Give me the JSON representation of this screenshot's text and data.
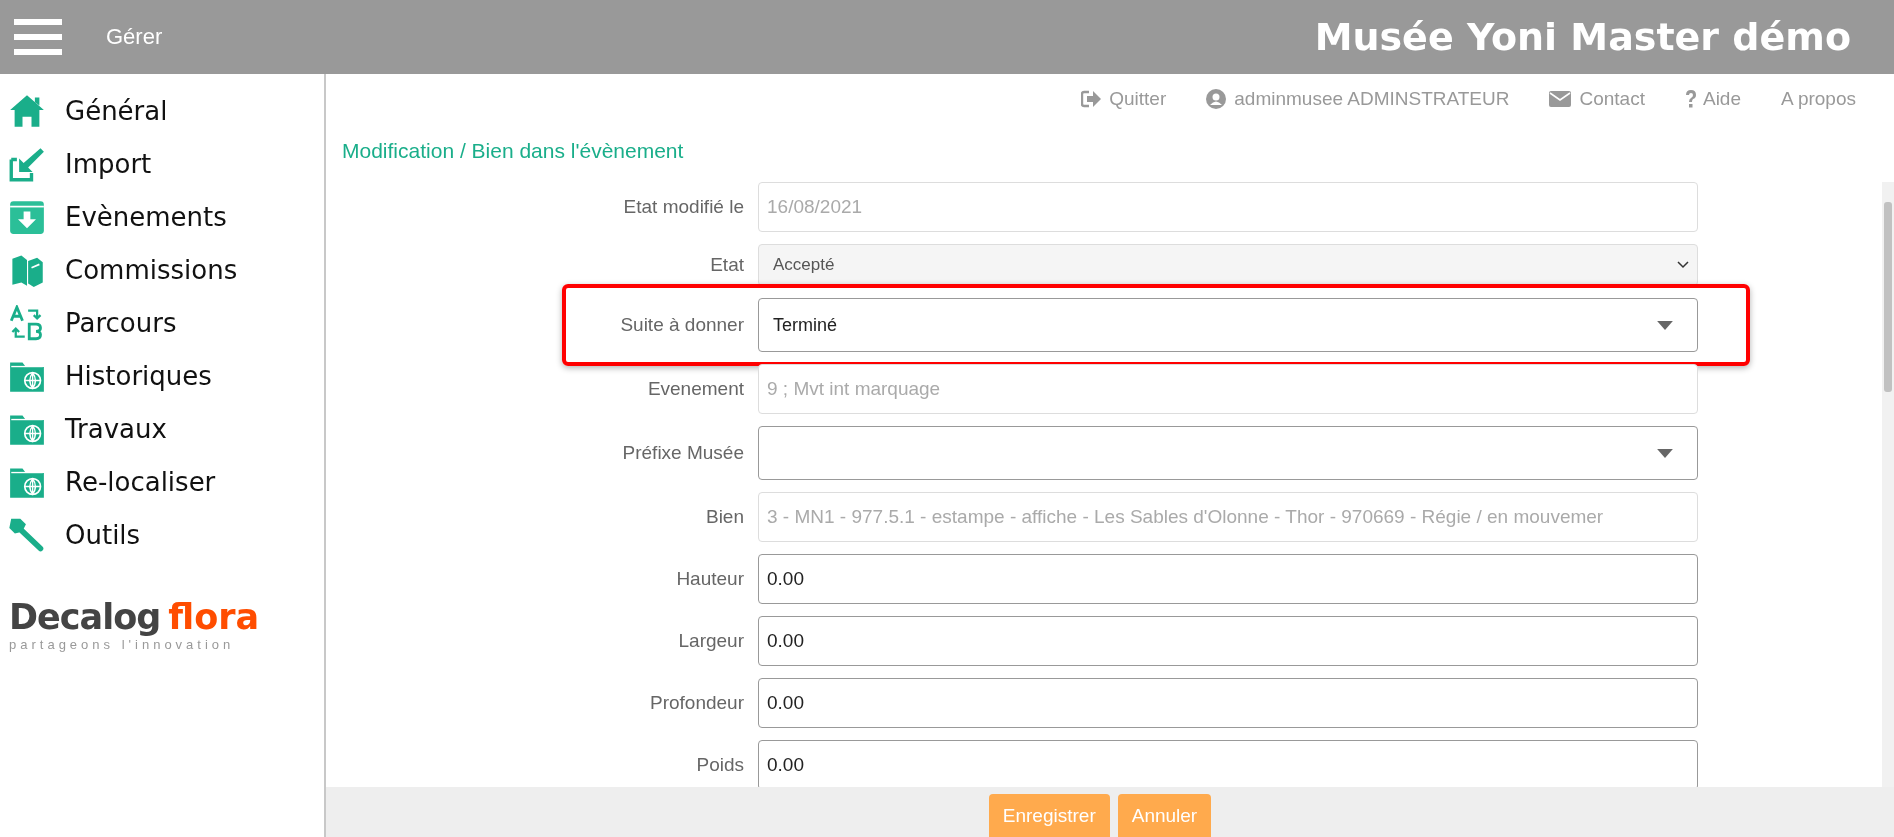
{
  "header": {
    "menu_label": "Gérer",
    "title": "Musée Yoni Master démo"
  },
  "sidebar": {
    "items": [
      {
        "label": "Général"
      },
      {
        "label": "Import"
      },
      {
        "label": "Evènements"
      },
      {
        "label": "Commissions"
      },
      {
        "label": "Parcours"
      },
      {
        "label": "Historiques"
      },
      {
        "label": "Travaux"
      },
      {
        "label": "Re-localiser"
      },
      {
        "label": "Outils"
      }
    ],
    "logo": {
      "part_1": "Decalog",
      "part_2": "flora",
      "tagline": "partageons l'innovation"
    }
  },
  "top_links": [
    {
      "label": "Quitter"
    },
    {
      "label": "adminmusee ADMINSTRATEUR"
    },
    {
      "label": "Contact"
    },
    {
      "label": "Aide"
    },
    {
      "label": "A propos"
    }
  ],
  "breadcrumb": "Modification / Bien dans l'évènement",
  "form": {
    "rows": [
      {
        "label": "Etat modifié le",
        "kind": "readonly",
        "value": "16/08/2021",
        "highlighted": false
      },
      {
        "label": "Etat",
        "kind": "disabled-select",
        "value": "Accepté",
        "highlighted": false
      },
      {
        "label": "Suite à donner",
        "kind": "select",
        "value": "Terminé",
        "highlighted": true
      },
      {
        "label": "Evenement",
        "kind": "readonly",
        "value": "9 ; Mvt int marquage",
        "highlighted": false
      },
      {
        "label": "Préfixe Musée",
        "kind": "select",
        "value": "",
        "highlighted": false
      },
      {
        "label": "Bien",
        "kind": "readonly",
        "value": "3 - MN1 - 977.5.1 - estampe - affiche - Les Sables d'Olonne - Thor - 970669 - Régie / en mouvemer",
        "highlighted": false
      },
      {
        "label": "Hauteur",
        "kind": "input",
        "value": "0.00",
        "highlighted": false
      },
      {
        "label": "Largeur",
        "kind": "input",
        "value": "0.00",
        "highlighted": false
      },
      {
        "label": "Profondeur",
        "kind": "input",
        "value": "0.00",
        "highlighted": false
      },
      {
        "label": "Poids",
        "kind": "input",
        "value": "0.00",
        "highlighted": false
      }
    ]
  },
  "buttons": [
    {
      "label": "Enregistrer"
    },
    {
      "label": "Annuler"
    }
  ]
}
